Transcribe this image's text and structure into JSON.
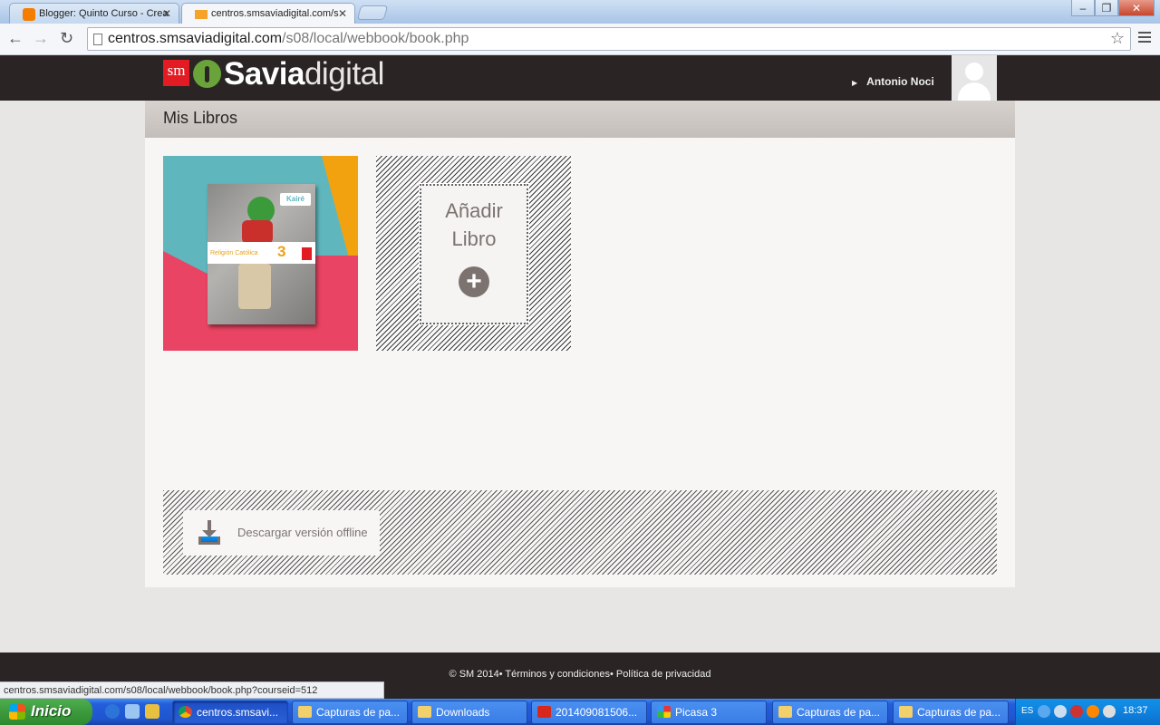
{
  "browser": {
    "tabs": [
      {
        "label": "Blogger: Quinto Curso - Crea",
        "favicon": "blogger-icon",
        "active": false
      },
      {
        "label": "centros.smsaviadigital.com/s",
        "favicon": "moodle-icon",
        "active": true
      }
    ],
    "url_host": "centros.smsaviadigital.com",
    "url_path": "/s08/local/webbook/book.php",
    "status_text": "centros.smsaviadigital.com/s08/local/webbook/book.php?courseid=512"
  },
  "header": {
    "logo_sm": "sm",
    "logo_savia": "Savia",
    "logo_digital": "digital",
    "user_name": "Antonio Noci"
  },
  "main": {
    "title": "Mis Libros",
    "book": {
      "series": "Kairé",
      "subject": "Religión Católica",
      "grade": "3"
    },
    "add_book": {
      "label_line1": "Añadir",
      "label_line2": "Libro"
    },
    "offline_label": "Descargar versión offline"
  },
  "footer": {
    "text": "© SM 2014• Términos y condiciones• Política de privacidad"
  },
  "taskbar": {
    "start_label": "Inicio",
    "tasks": [
      {
        "label": "centros.smsavi...",
        "icon": "chrome-icon"
      },
      {
        "label": "Capturas de pa...",
        "icon": "folder-icon"
      },
      {
        "label": "Downloads",
        "icon": "folder-icon"
      },
      {
        "label": "201409081506...",
        "icon": "pdf-icon"
      },
      {
        "label": "Picasa 3",
        "icon": "picasa-icon"
      },
      {
        "label": "Capturas de pa...",
        "icon": "folder-icon"
      },
      {
        "label": "Capturas de pa...",
        "icon": "folder-icon"
      }
    ],
    "language": "ES",
    "clock": "18:37"
  },
  "colors": {
    "header_bg": "#2a2524",
    "brand_red": "#e31b23",
    "brand_green": "#6aa33a",
    "accent_gray": "#7c7370"
  }
}
